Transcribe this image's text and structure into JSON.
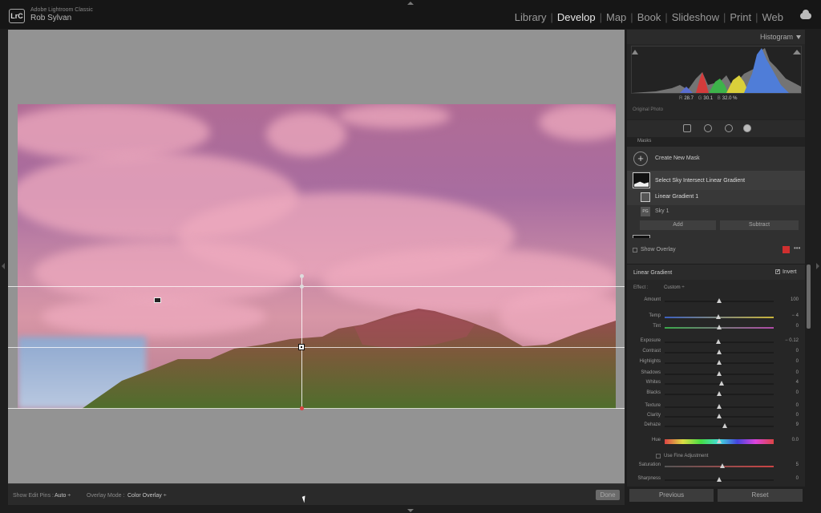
{
  "app": {
    "logo": "LrC",
    "app_name": "Adobe Lightroom Classic",
    "user": "Rob Sylvan"
  },
  "modules": [
    "Library",
    "Develop",
    "Map",
    "Book",
    "Slideshow",
    "Print",
    "Web"
  ],
  "active_module": "Develop",
  "toolbar": {
    "show_edit_pins_label": "Show Edit Pins :",
    "show_edit_pins_value": "Auto ÷",
    "overlay_mode_label": "Overlay Mode :",
    "overlay_mode_value": "Color Overlay ÷",
    "done": "Done"
  },
  "histogram": {
    "title": "Histogram",
    "r_label": "R",
    "r_value": "28.7",
    "g_label": "G",
    "g_value": "30.1",
    "b_label": "B",
    "b_value": "32.0 %",
    "original_photo": "Original Photo"
  },
  "masks": {
    "header": "Masks",
    "create_new": "Create New Mask",
    "mask_name": "Select Sky Intersect Linear Gradient",
    "component_1": "Linear Gradient 1",
    "component_2": "Sky 1",
    "component_2_badge": "PG",
    "add": "Add",
    "subtract": "Subtract",
    "show_overlay": "Show Overlay",
    "overlay_color": "#cf2f2f"
  },
  "linear_gradient": {
    "title": "Linear Gradient",
    "invert_label": "Invert",
    "invert_checked": true,
    "effect_label": "Effect :",
    "effect_value": "Custom ÷"
  },
  "sliders": [
    {
      "name": "Amount",
      "value": "100",
      "pos": 0.5,
      "style": ""
    },
    {
      "name": "Temp",
      "value": "− 4",
      "pos": 0.49,
      "style": "temp"
    },
    {
      "name": "Tint",
      "value": "0",
      "pos": 0.5,
      "style": "tint"
    },
    {
      "name": "Exposure",
      "value": "− 0.12",
      "pos": 0.49,
      "style": ""
    },
    {
      "name": "Contrast",
      "value": "0",
      "pos": 0.5,
      "style": ""
    },
    {
      "name": "Highlights",
      "value": "0",
      "pos": 0.5,
      "style": ""
    },
    {
      "name": "Shadows",
      "value": "0",
      "pos": 0.5,
      "style": ""
    },
    {
      "name": "Whites",
      "value": "4",
      "pos": 0.52,
      "style": ""
    },
    {
      "name": "Blacks",
      "value": "0",
      "pos": 0.5,
      "style": ""
    },
    {
      "name": "Texture",
      "value": "0",
      "pos": 0.5,
      "style": ""
    },
    {
      "name": "Clarity",
      "value": "0",
      "pos": 0.5,
      "style": ""
    },
    {
      "name": "Dehaze",
      "value": "9",
      "pos": 0.55,
      "style": ""
    },
    {
      "name": "Hue",
      "value": "0.0",
      "pos": 0.5,
      "style": "hue"
    },
    {
      "name": "Saturation",
      "value": "5",
      "pos": 0.53,
      "style": "sat"
    },
    {
      "name": "Sharpness",
      "value": "0",
      "pos": 0.5,
      "style": ""
    }
  ],
  "fine_adjustment": "Use Fine Adjustment",
  "footer": {
    "previous": "Previous",
    "reset": "Reset"
  }
}
